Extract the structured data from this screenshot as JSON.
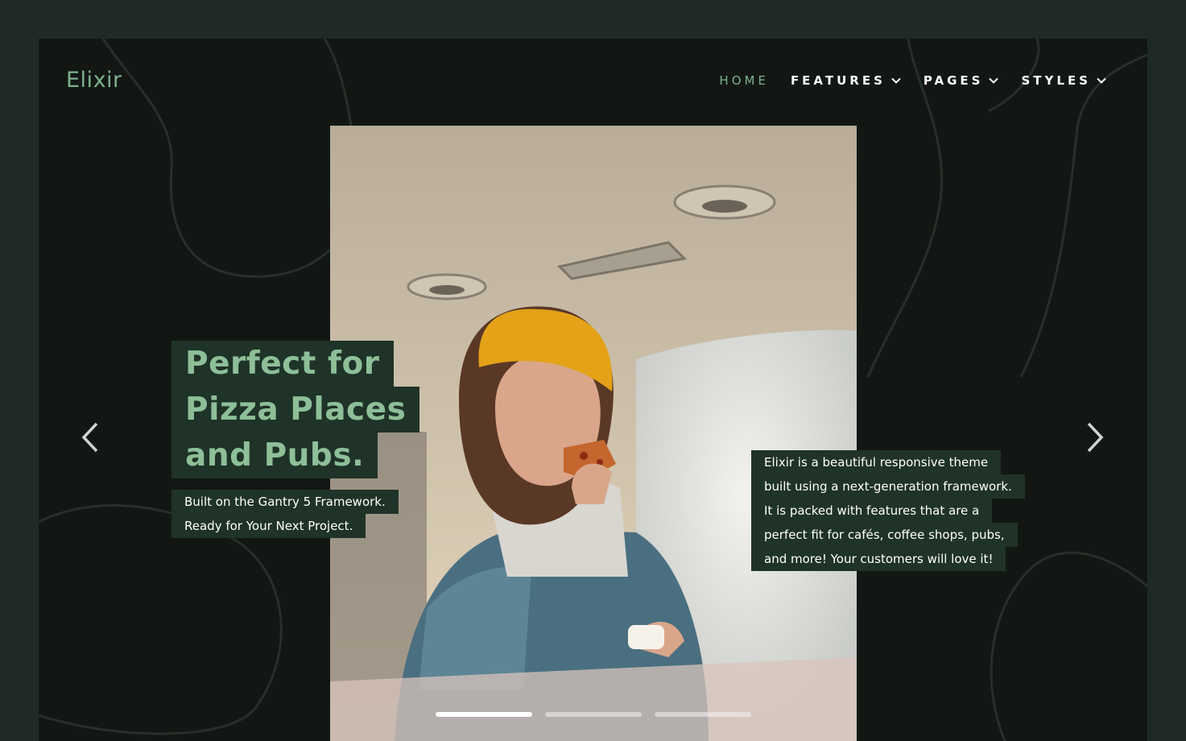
{
  "brand": {
    "name": "Elixir"
  },
  "nav": {
    "items": [
      {
        "label": "HOME",
        "active": true,
        "has_dropdown": false
      },
      {
        "label": "FEATURES",
        "active": false,
        "has_dropdown": true
      },
      {
        "label": "PAGES",
        "active": false,
        "has_dropdown": true
      },
      {
        "label": "STYLES",
        "active": false,
        "has_dropdown": true
      }
    ]
  },
  "hero": {
    "headline_lines": [
      "Perfect for",
      "Pizza Places",
      "and Pubs."
    ],
    "subline_lines": [
      "Built on the Gantry 5 Framework.",
      "Ready for Your Next Project."
    ],
    "description_lines": [
      "Elixir is a beautiful responsive theme",
      "built using a next-generation framework.",
      "It is packed with features that are a",
      "perfect fit for cafés, coffee shops, pubs,",
      "and more! Your customers will love it!"
    ],
    "image_subject": "woman-eating-pizza-photo"
  },
  "slider": {
    "slide_count": 3,
    "active_index": 0,
    "prev_icon": "chevron-left-icon",
    "next_icon": "chevron-right-icon"
  },
  "colors": {
    "outer_background": "#1f2a24",
    "frame_background": "#121714",
    "accent_green": "#7fb08c",
    "text_box_background": "#1f3328",
    "nav_text": "#ffffff"
  }
}
